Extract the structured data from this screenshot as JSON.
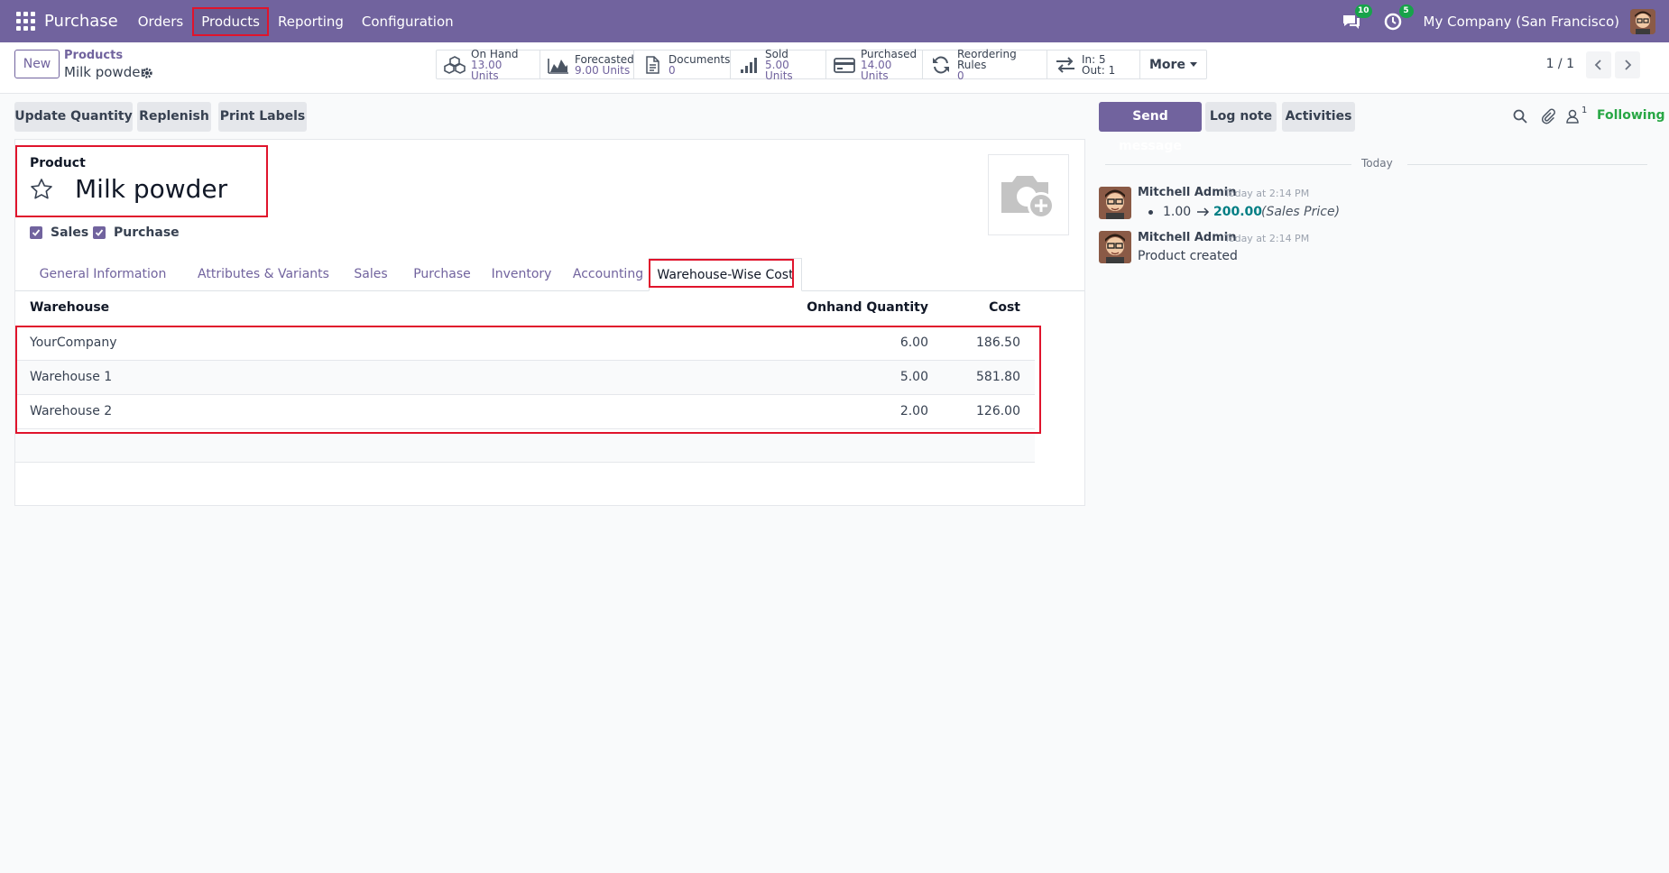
{
  "navbar": {
    "app_name": "Purchase",
    "menu": [
      "Orders",
      "Products",
      "Reporting",
      "Configuration"
    ],
    "messages_badge": "10",
    "activities_badge": "5",
    "company": "My Company (San Francisco)",
    "bg_color": "#71639e"
  },
  "control_panel": {
    "new_label": "New",
    "breadcrumb_parent": "Products",
    "breadcrumb_current": "Milk powder",
    "smart_buttons": [
      {
        "icon": "cubes-icon",
        "title": "On Hand",
        "value": "13.00 Units"
      },
      {
        "icon": "area-chart-icon",
        "title": "Forecasted",
        "value": "9.00 Units"
      },
      {
        "icon": "document-icon",
        "title": "Documents",
        "value": "0"
      },
      {
        "icon": "signal-icon",
        "title": "Sold",
        "value": "5.00 Units"
      },
      {
        "icon": "credit-card-icon",
        "title": "Purchased",
        "value": "14.00 Units"
      },
      {
        "icon": "refresh-icon",
        "title": "Reordering Rules",
        "value": "0"
      },
      {
        "icon": "exchange-icon",
        "title": "In: 5",
        "value": "Out: 1"
      }
    ],
    "more_label": "More",
    "pager": "1 / 1"
  },
  "actions": {
    "update_quantity": "Update Quantity",
    "replenish": "Replenish",
    "print_labels": "Print Labels"
  },
  "form": {
    "product_label": "Product",
    "product_name": "Milk powder",
    "sales_label": "Sales",
    "purchase_label": "Purchase",
    "tabs": [
      "General Information",
      "Attributes & Variants",
      "Sales",
      "Purchase",
      "Inventory",
      "Accounting",
      "Warehouse-Wise Cost"
    ],
    "active_tab": "Warehouse-Wise Cost",
    "table": {
      "headers": [
        "Warehouse",
        "Onhand Quantity",
        "Cost"
      ],
      "rows": [
        [
          "YourCompany",
          "6.00",
          "186.50"
        ],
        [
          "Warehouse 1",
          "5.00",
          "581.80"
        ],
        [
          "Warehouse 2",
          "2.00",
          "126.00"
        ]
      ]
    }
  },
  "chatter": {
    "send_message": "Send message",
    "log_note": "Log note",
    "activities": "Activities",
    "followers_count": "1",
    "following": "Following",
    "today": "Today",
    "messages": [
      {
        "author": "Mitchell Admin",
        "time": "Today at 2:14 PM",
        "old": "1.00",
        "new": "200.00",
        "field": "(Sales Price)"
      },
      {
        "author": "Mitchell Admin",
        "time": "Today at 2:14 PM",
        "body": "Product created"
      }
    ]
  }
}
